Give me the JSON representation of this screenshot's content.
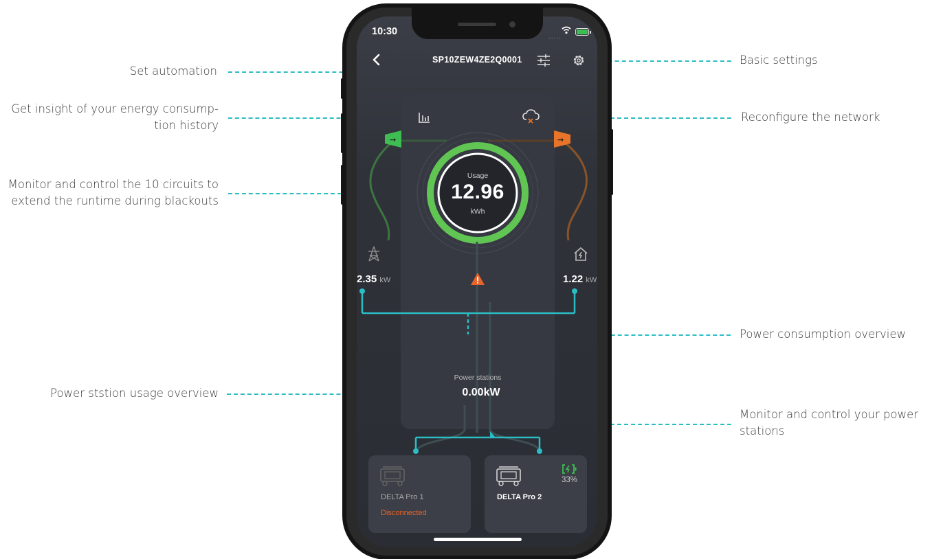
{
  "callouts": {
    "set_automation": "Set automation",
    "energy_history": "Get insight of your energy consumption history",
    "energy_history_line1": "Get insight of your energy consump-",
    "energy_history_line2": "tion history",
    "circuits_line1": "Monitor and control the 10 circuits to",
    "circuits_line2": "extend the runtime during blackouts",
    "ps_usage": "Power ststion usage overview",
    "basic_settings": "Basic settings",
    "reconfigure": "Reconfigure the network",
    "consumption": "Power consumption overview",
    "stations_line1": "Monitor and control your power",
    "stations_line2": "stations"
  },
  "status_bar": {
    "time": "10:30",
    "signal": "....."
  },
  "header": {
    "device_id": "SP10ZEW4ZE2Q0001"
  },
  "usage": {
    "label": "Usage",
    "value": "12.96",
    "unit": "kWh"
  },
  "grid": {
    "value": "2.35",
    "unit": "kW"
  },
  "home": {
    "value": "1.22",
    "unit": "kW"
  },
  "power_stations": {
    "label": "Power stations",
    "value": "0.00kW"
  },
  "stations": [
    {
      "name": "DELTA Pro 1",
      "status": "Disconnected"
    },
    {
      "name": "DELTA Pro 2",
      "battery": "33%"
    }
  ],
  "colors": {
    "accent": "#2bbcc4",
    "grid_green": "#3ebd52",
    "home_orange": "#e8742a",
    "warning": "#e8642a"
  },
  "icons": [
    "back-icon",
    "automation-sliders-icon",
    "gear-icon",
    "bar-chart-icon",
    "cloud-error-icon",
    "power-tower-icon",
    "house-bolt-icon",
    "warning-icon",
    "battery-charging-icon",
    "power-station-icon"
  ]
}
